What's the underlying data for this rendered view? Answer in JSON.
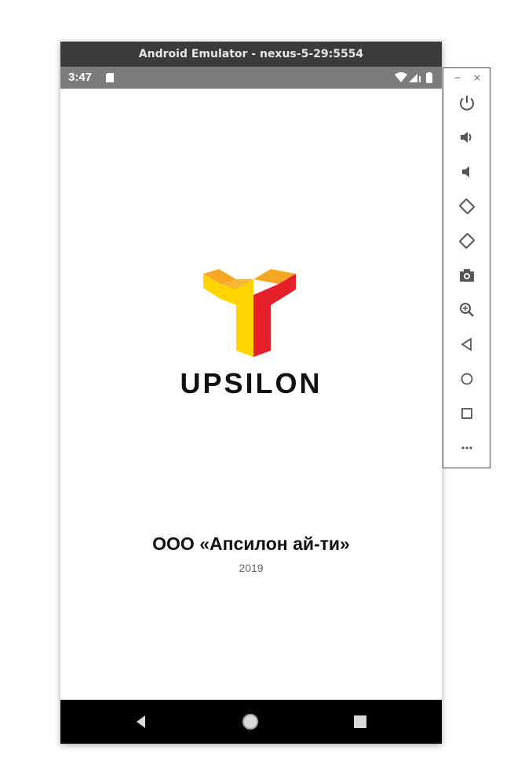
{
  "window": {
    "title": "Android Emulator - nexus-5-29:5554"
  },
  "statusbar": {
    "time": "3:47",
    "icons": [
      "sd-card-icon",
      "wifi-icon",
      "signal-icon",
      "battery-icon"
    ]
  },
  "app": {
    "logo_text": "UPSILON",
    "company_name": "ООО «Апсилон ай-ти»",
    "year": "2019",
    "colors": {
      "logo_yellow": "#FFD400",
      "logo_orange": "#F5A623",
      "logo_red": "#E5202A",
      "logo_text": "#111111"
    }
  },
  "navbar": {
    "buttons": [
      "back-icon",
      "home-icon",
      "recents-icon"
    ]
  },
  "toolbar": {
    "minimize": "−",
    "close": "×",
    "buttons": [
      "power-icon",
      "volume-up-icon",
      "volume-down-icon",
      "rotate-left-icon",
      "rotate-right-icon",
      "camera-icon",
      "zoom-icon",
      "back-icon",
      "home-icon",
      "overview-icon",
      "more-icon"
    ]
  }
}
